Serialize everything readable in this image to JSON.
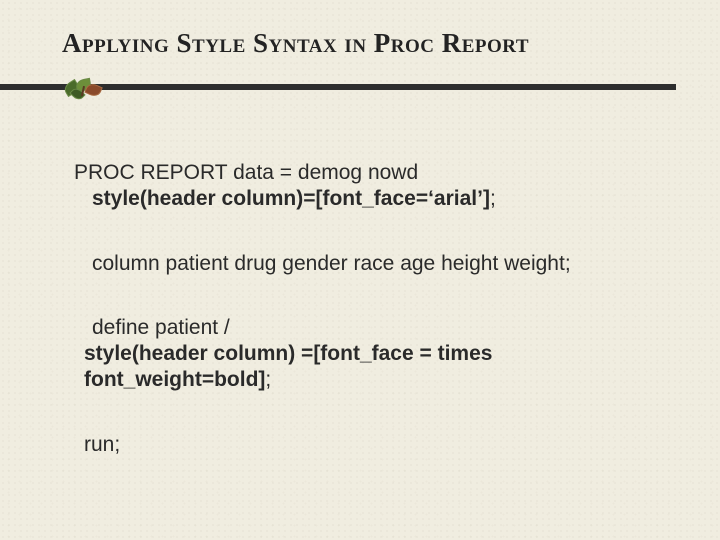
{
  "title": "Applying Style Syntax in Proc Report",
  "lines": {
    "l1": "PROC REPORT  data = demog nowd",
    "l2": "style(header column)=[font_face=‘arial’]",
    "l2_semi": ";",
    "l3": "column patient drug gender race age height weight;",
    "l4": "define patient /",
    "l5": "style(header column) =[font_face = times font_weight=bold]",
    "l5_semi": ";",
    "l6": "run;"
  }
}
